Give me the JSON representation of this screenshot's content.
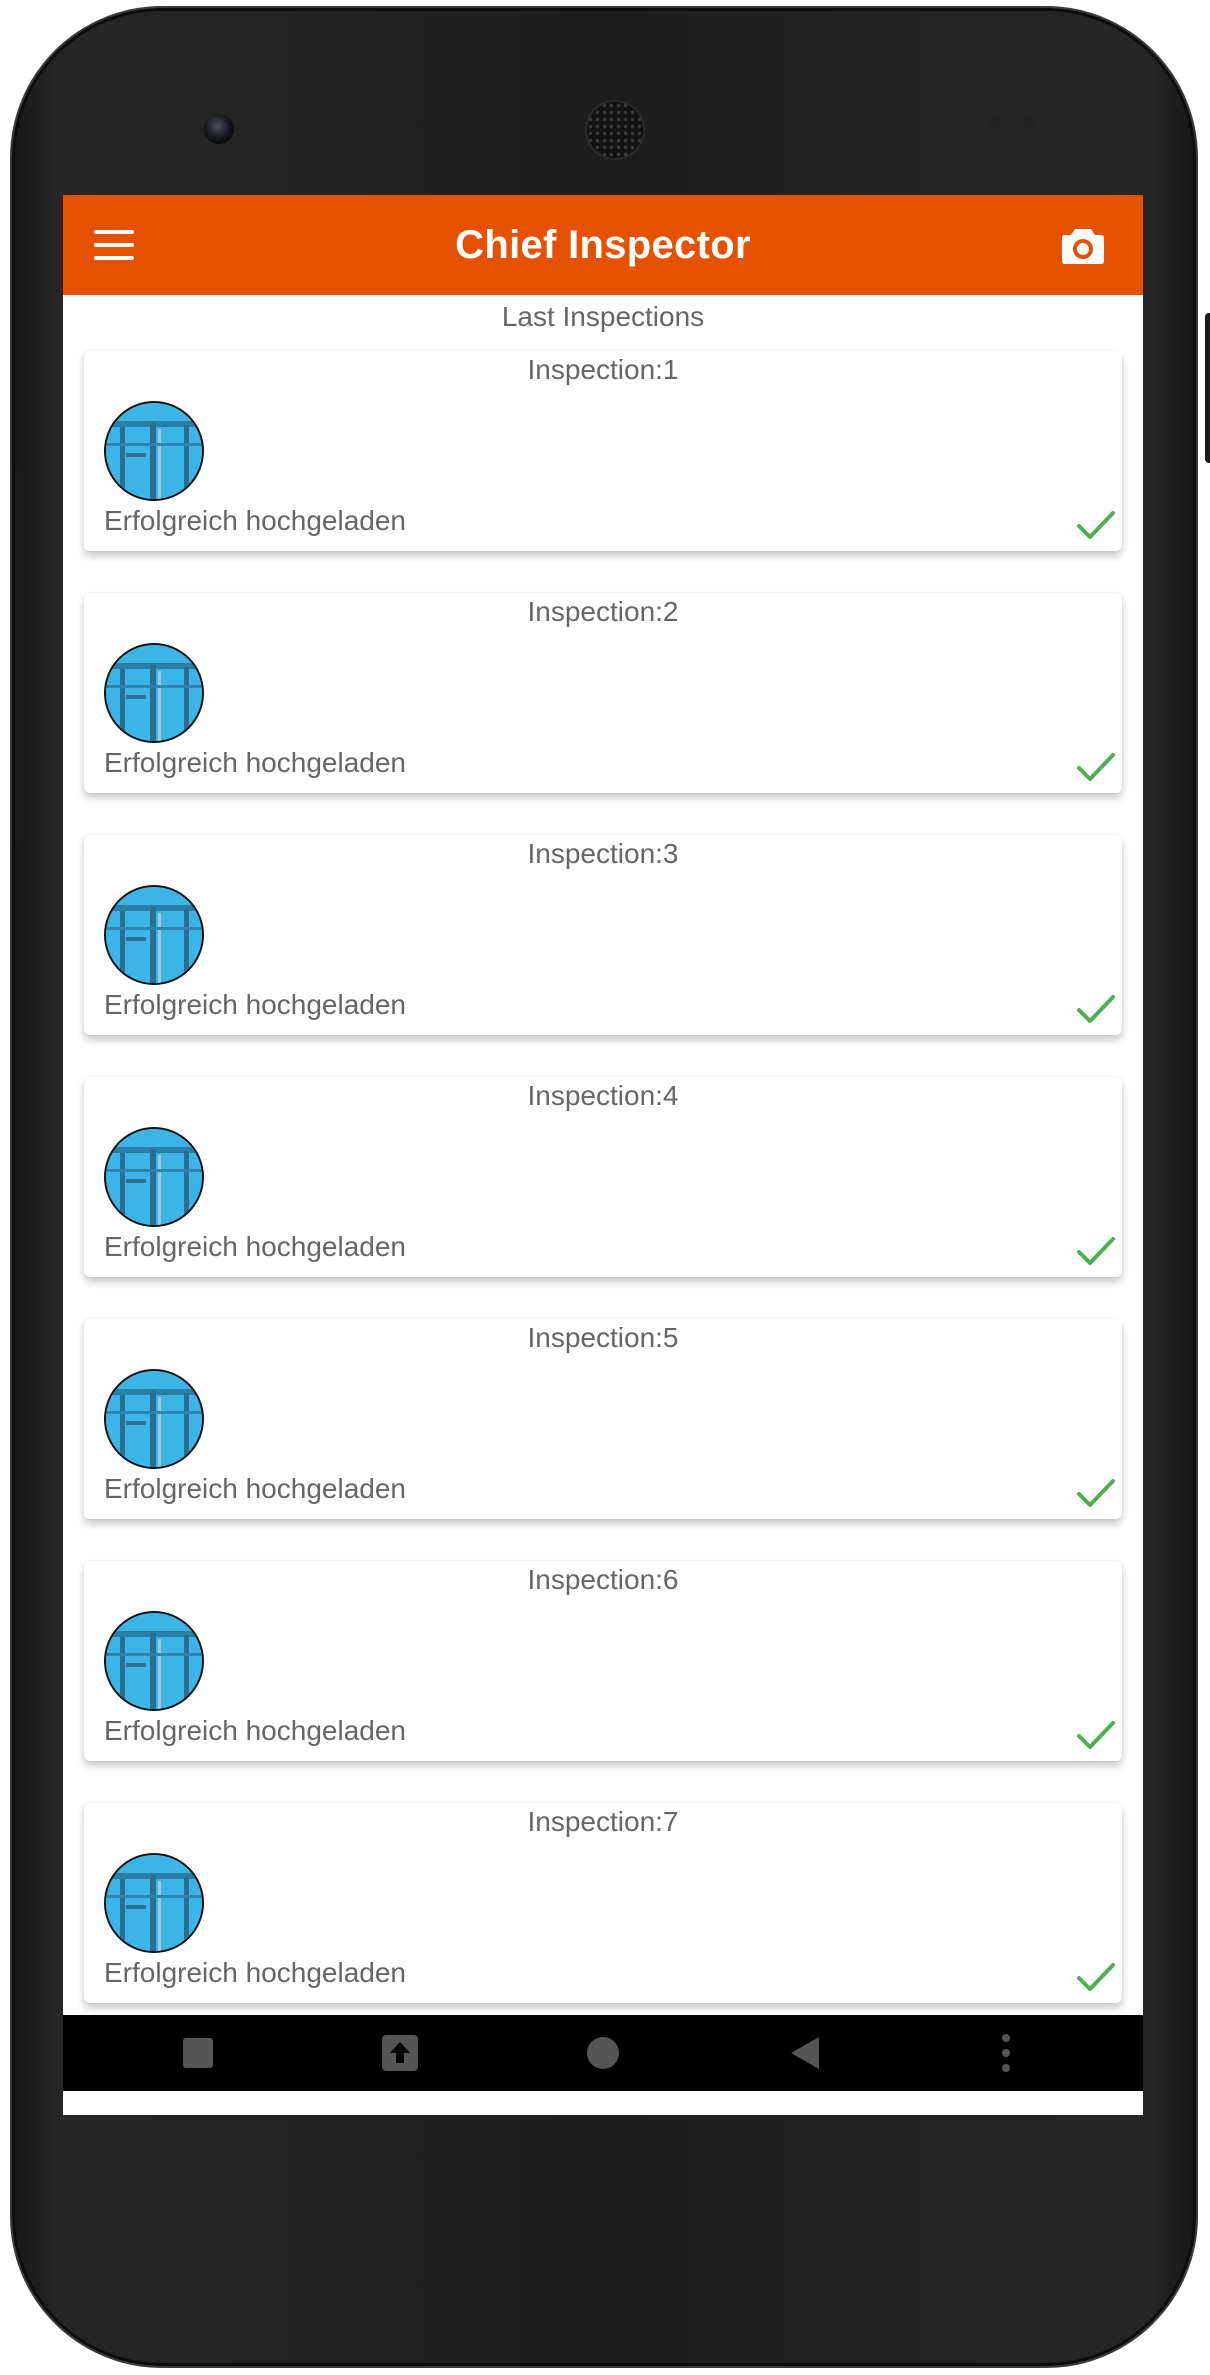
{
  "app": {
    "title": "Chief Inspector",
    "accent_color": "#e65100",
    "menu_icon": "hamburger-menu-icon",
    "camera_icon": "camera-icon"
  },
  "list": {
    "header": "Last Inspections",
    "items": [
      {
        "title": "Inspection:1",
        "status": "Erfolgreich hochgeladen",
        "status_icon": "check-icon"
      },
      {
        "title": "Inspection:2",
        "status": "Erfolgreich hochgeladen",
        "status_icon": "check-icon"
      },
      {
        "title": "Inspection:3",
        "status": "Erfolgreich hochgeladen",
        "status_icon": "check-icon"
      },
      {
        "title": "Inspection:4",
        "status": "Erfolgreich hochgeladen",
        "status_icon": "check-icon"
      },
      {
        "title": "Inspection:5",
        "status": "Erfolgreich hochgeladen",
        "status_icon": "check-icon"
      },
      {
        "title": "Inspection:6",
        "status": "Erfolgreich hochgeladen",
        "status_icon": "check-icon"
      },
      {
        "title": "Inspection:7",
        "status": "Erfolgreich hochgeladen",
        "status_icon": "check-icon"
      }
    ]
  },
  "navbar": {
    "buttons": [
      "square-icon",
      "upload-icon",
      "home-circle-icon",
      "back-triangle-icon",
      "more-vertical-icon"
    ]
  },
  "colors": {
    "check": "#4caf50",
    "thumbnail": "#3cb4e6"
  }
}
